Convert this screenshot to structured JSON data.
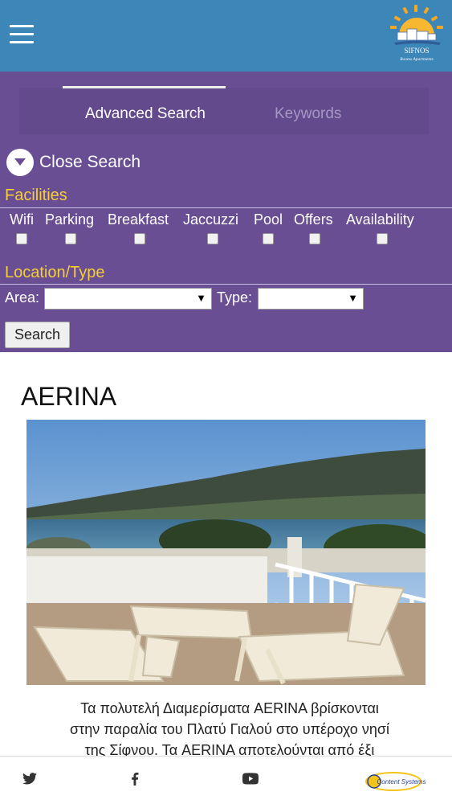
{
  "header": {
    "menu_icon": "hamburger-menu-icon",
    "logo": {
      "line1": "SIFNOS",
      "line2": "Rooms Apartments"
    }
  },
  "search": {
    "tabs": [
      {
        "label": "Advanced Search",
        "active": true
      },
      {
        "label": "Keywords",
        "active": false
      }
    ],
    "close_label": "Close Search",
    "facilities": {
      "title": "Facilities",
      "options": [
        {
          "label": "Wifi",
          "checked": false
        },
        {
          "label": "Parking",
          "checked": false
        },
        {
          "label": "Breakfast",
          "checked": false
        },
        {
          "label": "Jaccuzzi",
          "checked": false
        },
        {
          "label": "Pool",
          "checked": false
        },
        {
          "label": "Offers",
          "checked": false
        },
        {
          "label": "Availability",
          "checked": false
        }
      ]
    },
    "location": {
      "title": "Location/Type",
      "area_label": "Area:",
      "area_value": "",
      "type_label": "Type:",
      "type_value": ""
    },
    "button_label": "Search"
  },
  "listing": {
    "title": "AERINA",
    "description_lines": [
      "Τα πολυτελή Διαμερίσματα AERINA βρίσκονται",
      "στην παραλία του Πλατύ Γιαλού στο υπέροχο νησί",
      "της Σίφνου. Τα AERINA αποτελούνται από έξι"
    ]
  },
  "footer": {
    "icons": [
      "twitter-icon",
      "facebook-icon",
      "youtube-icon"
    ],
    "brand": "Content Systems"
  },
  "colors": {
    "header": "#3d86b8",
    "panel": "#6a4e94",
    "accent_yellow": "#f4cf36"
  }
}
